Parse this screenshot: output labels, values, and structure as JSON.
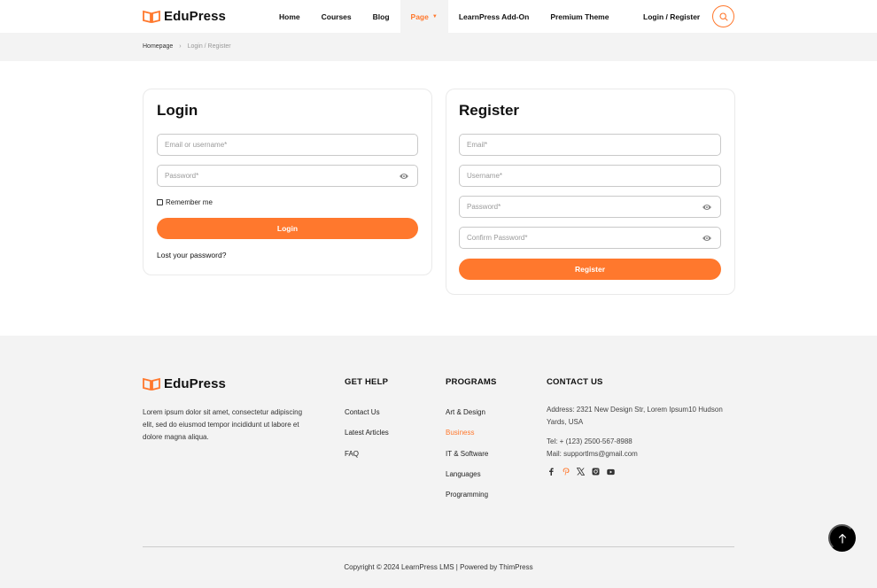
{
  "brand": {
    "name": "EduPress",
    "accent": "#ff782d"
  },
  "nav": {
    "items": [
      {
        "label": "Home"
      },
      {
        "label": "Courses"
      },
      {
        "label": "Blog"
      },
      {
        "label": "Page",
        "active": true
      },
      {
        "label": "LearnPress Add-On"
      },
      {
        "label": "Premium Theme"
      }
    ],
    "login_register": "Login / Register"
  },
  "breadcrumb": {
    "home": "Homepage",
    "separator": "›",
    "current": "Login / Register"
  },
  "login": {
    "title": "Login",
    "username_placeholder": "Email or username*",
    "password_placeholder": "Password*",
    "remember": "Remember me",
    "button": "Login",
    "lost_password": "Lost your password?"
  },
  "register": {
    "title": "Register",
    "email_placeholder": "Email*",
    "username_placeholder": "Username*",
    "password_placeholder": "Password*",
    "confirm_placeholder": "Confirm Password*",
    "button": "Register"
  },
  "footer": {
    "about": "Lorem ipsum dolor sit amet, consectetur adipiscing elit, sed do eiusmod tempor incididunt ut labore et dolore magna aliqua.",
    "get_help": {
      "heading": "GET HELP",
      "links": [
        "Contact Us",
        "Latest Articles",
        "FAQ"
      ]
    },
    "programs": {
      "heading": "PROGRAMS",
      "links": [
        "Art & Design",
        "Business",
        "IT & Software",
        "Languages",
        "Programming"
      ],
      "highlighted": "Business"
    },
    "contact": {
      "heading": "CONTACT US",
      "address": "Address: 2321 New Design Str, Lorem Ipsum10 Hudson Yards, USA",
      "tel": "Tel: + (123) 2500-567-8988",
      "mail": "Mail: supportlms@gmail.com"
    },
    "socials": [
      "facebook-icon",
      "pinterest-icon",
      "x-icon",
      "instagram-icon",
      "youtube-icon"
    ],
    "copyright": "Copyright © 2024 LearnPress LMS | Powered by ThimPress"
  }
}
